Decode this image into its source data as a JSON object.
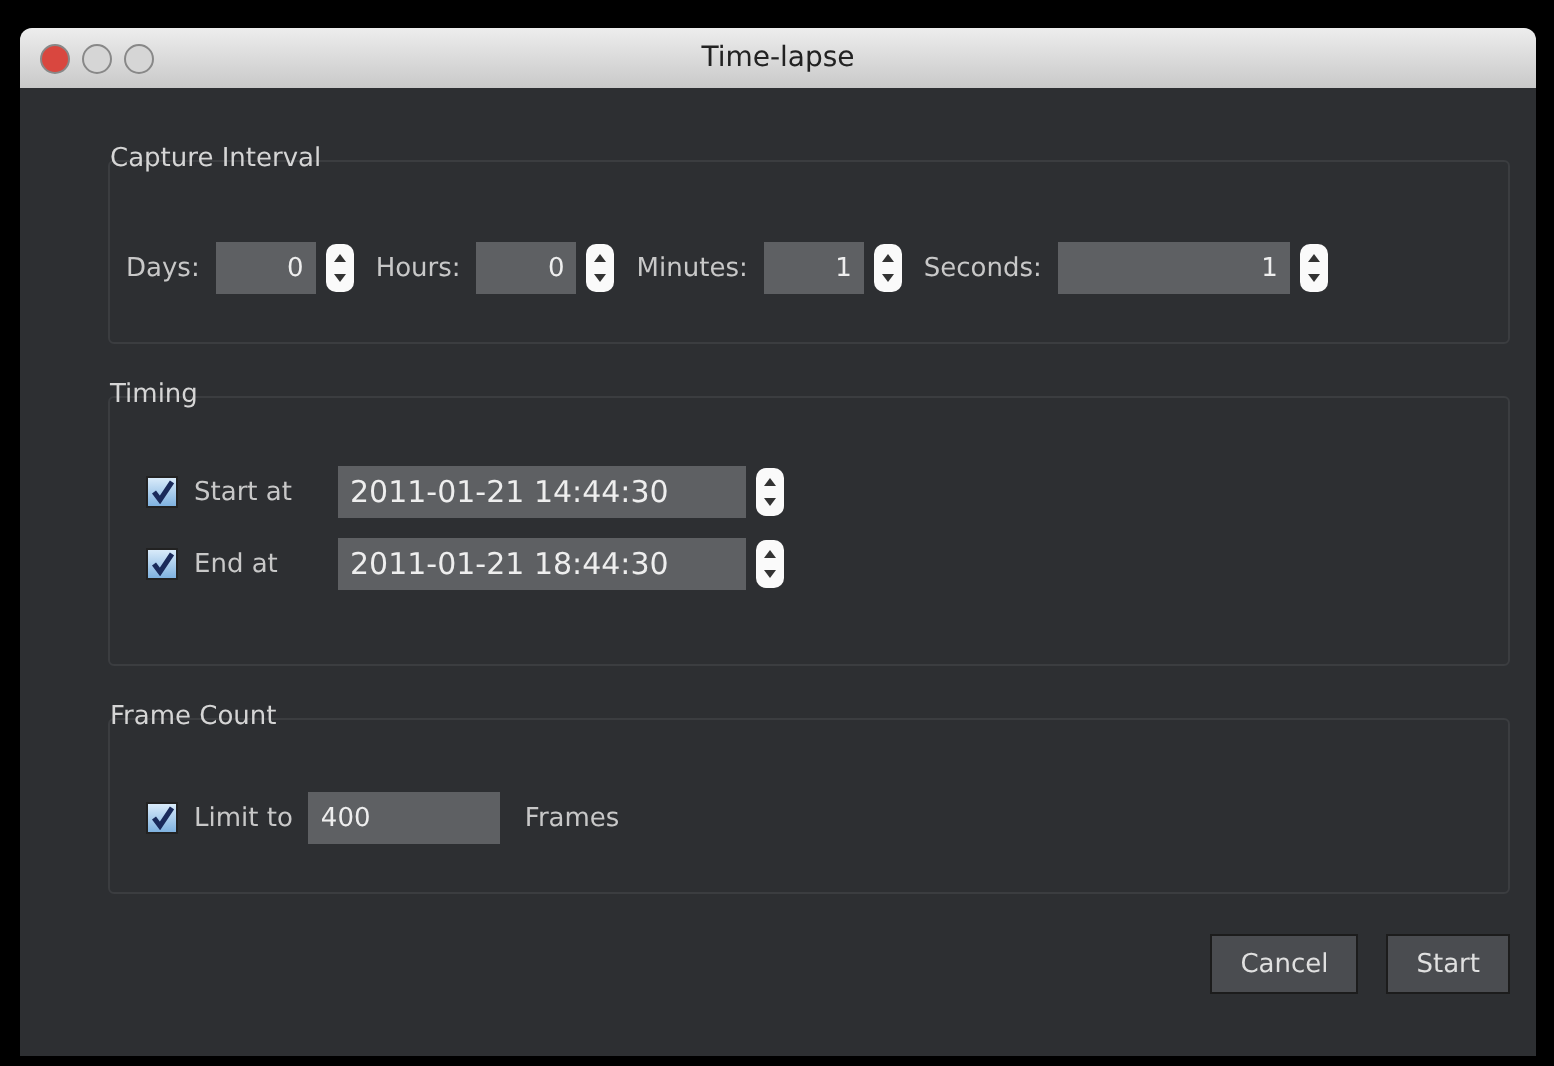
{
  "window": {
    "title": "Time-lapse"
  },
  "capture_interval": {
    "title": "Capture Interval",
    "fields": [
      {
        "label": "Days:",
        "value": "0",
        "wide": false
      },
      {
        "label": "Hours:",
        "value": "0",
        "wide": false
      },
      {
        "label": "Minutes:",
        "value": "1",
        "wide": false
      },
      {
        "label": "Seconds:",
        "value": "1",
        "wide": true
      }
    ]
  },
  "timing": {
    "title": "Timing",
    "rows": [
      {
        "label": "Start at",
        "checked": true,
        "value": "2011-01-21 14:44:30"
      },
      {
        "label": "End at",
        "checked": true,
        "value": "2011-01-21 18:44:30"
      }
    ]
  },
  "frame_count": {
    "title": "Frame Count",
    "label": "Limit to",
    "checked": true,
    "value": "400",
    "unit": "Frames"
  },
  "buttons": [
    "Cancel",
    "Start"
  ]
}
